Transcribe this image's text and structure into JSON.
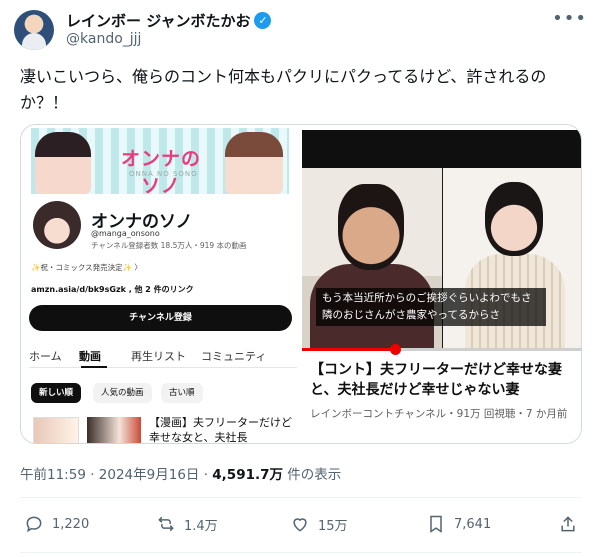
{
  "author": {
    "name": "レインボー ジャンボたかお",
    "handle": "@kando_jjj",
    "verified": true
  },
  "tweet": {
    "text": "凄いこいつら、俺らのコント何本もパクリにパクってるけど、許されるのか？！"
  },
  "channel_card": {
    "banner_logo": "オンナのソノ",
    "banner_sub": "ONNA NO SONO",
    "name": "オンナのソノ",
    "handle": "@manga_onsono",
    "stats": "チャンネル登録者数 18.5万人・919 本の動画",
    "promo": "✨祝・コミックス発売決定✨ 〉",
    "link": "amzn.asia/d/bk9sGzk , 他 2 件のリンク",
    "subscribe_label": "チャンネル登録",
    "tabs": [
      {
        "label": "ホーム"
      },
      {
        "label": "動画"
      },
      {
        "label": "再生リスト"
      },
      {
        "label": "コミュニティ"
      }
    ],
    "chips": [
      {
        "label": "新しい順"
      },
      {
        "label": "人気の動画"
      },
      {
        "label": "古い順"
      }
    ],
    "mini_title": "【漫画】夫フリーターだけど幸せな女と、夫社長"
  },
  "video_card": {
    "caption": "もう本当近所からのご挨拶ぐらいよわでもさ隣のおじさんがさ農家やってるからさ",
    "progress": 0.33,
    "title": "【コント】夫フリーターだけど幸せな妻と、夫社長だけど幸せじゃない妻",
    "meta": "レインボーコントチャンネル・91万 回視聴・7 か月前"
  },
  "timestamp": {
    "time": "午前11:59 · 2024年9月16日 · ",
    "views": "4,591.7万",
    "views_suffix": " 件の表示"
  },
  "actions": {
    "replies": "1,220",
    "retweets": "1.4万",
    "likes": "15万",
    "bookmarks": "7,641"
  },
  "colors": {
    "accent": "#1d9bf0",
    "muted": "#536471",
    "progress_red": "#ee0000"
  },
  "icons": [
    "verified-icon",
    "more-icon",
    "reply-icon",
    "retweet-icon",
    "like-icon",
    "bookmark-icon",
    "share-icon"
  ]
}
